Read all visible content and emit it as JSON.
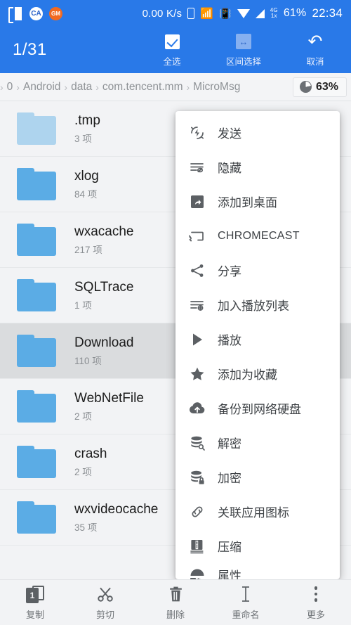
{
  "statusbar": {
    "left_icons": [
      {
        "name": "listen-app-icon",
        "glyph": "听"
      },
      {
        "name": "white-app-icon",
        "glyph": "CA"
      },
      {
        "name": "orange-app-icon",
        "glyph": "GM"
      }
    ],
    "net_speed": "0.00 K/s",
    "icons": [
      {
        "name": "sim-card-icon"
      },
      {
        "name": "bluetooth-icon",
        "glyph": "✶"
      },
      {
        "name": "vibrate-icon",
        "glyph": "░"
      },
      {
        "name": "wifi-icon"
      },
      {
        "name": "signal-icon"
      }
    ],
    "data_label_top": "4G",
    "data_label_bottom": "1x",
    "battery": "61%",
    "time": "22:34"
  },
  "actionbar": {
    "count": "1/31",
    "actions": [
      {
        "label": "全选",
        "icon": "checkbox-icon"
      },
      {
        "label": "区间选择",
        "icon": "range-select-icon"
      },
      {
        "label": "取消",
        "icon": "undo-icon"
      }
    ]
  },
  "breadcrumb": {
    "items": [
      "0",
      "Android",
      "data",
      "com.tencent.mm",
      "MicroMsg"
    ],
    "separator": "›",
    "storage_percent": "63%",
    "storage_icon": "pie-chart-icon"
  },
  "files": [
    {
      "name": ".tmp",
      "meta": "3 项",
      "hidden": true,
      "selected": false,
      "checked": false
    },
    {
      "name": "xlog",
      "meta": "84 项",
      "hidden": false,
      "selected": false,
      "checked": false
    },
    {
      "name": "wxacache",
      "meta": "217 项",
      "hidden": false,
      "selected": false,
      "checked": false
    },
    {
      "name": "SQLTrace",
      "meta": "1 项",
      "hidden": false,
      "selected": false,
      "checked": false
    },
    {
      "name": "Download",
      "meta": "110 项",
      "hidden": false,
      "selected": true,
      "checked": true
    },
    {
      "name": "WebNetFile",
      "meta": "2 项",
      "hidden": false,
      "selected": false,
      "checked": false
    },
    {
      "name": "crash",
      "meta": "2 项",
      "hidden": false,
      "selected": false,
      "checked": false
    },
    {
      "name": "wxvideocache",
      "meta": "35 项",
      "hidden": false,
      "selected": false,
      "checked": false
    }
  ],
  "context_menu": {
    "items": [
      {
        "label": "发送",
        "icon": "send-flash-icon"
      },
      {
        "label": "隐藏",
        "icon": "hide-eye-icon"
      },
      {
        "label": "添加到桌面",
        "icon": "add-to-desktop-icon"
      },
      {
        "label": "CHROMECAST",
        "icon": "chromecast-icon",
        "caps": true
      },
      {
        "label": "分享",
        "icon": "share-icon"
      },
      {
        "label": "加入播放列表",
        "icon": "add-to-playlist-icon"
      },
      {
        "label": "播放",
        "icon": "play-icon"
      },
      {
        "label": "添加为收藏",
        "icon": "star-icon"
      },
      {
        "label": "备份到网络硬盘",
        "icon": "cloud-upload-icon"
      },
      {
        "label": "解密",
        "icon": "decrypt-icon"
      },
      {
        "label": "加密",
        "icon": "encrypt-lock-icon"
      },
      {
        "label": "关联应用图标",
        "icon": "link-icon"
      },
      {
        "label": "压缩",
        "icon": "compress-icon"
      },
      {
        "label": "属性",
        "icon": "properties-icon",
        "cut_off": true
      }
    ]
  },
  "bottombar": {
    "items": [
      {
        "label": "复制",
        "icon": "copy-icon",
        "badge": "1"
      },
      {
        "label": "剪切",
        "icon": "scissors-icon"
      },
      {
        "label": "删除",
        "icon": "trash-icon"
      },
      {
        "label": "重命名",
        "icon": "rename-cursor-icon"
      },
      {
        "label": "更多",
        "icon": "more-vertical-icon"
      }
    ]
  },
  "colors": {
    "primary": "#2979e8",
    "folder": "#5bace5",
    "folder_hidden": "#aed4ee",
    "page_bg": "#f2f3f5",
    "selected_row": "#dadcde"
  }
}
